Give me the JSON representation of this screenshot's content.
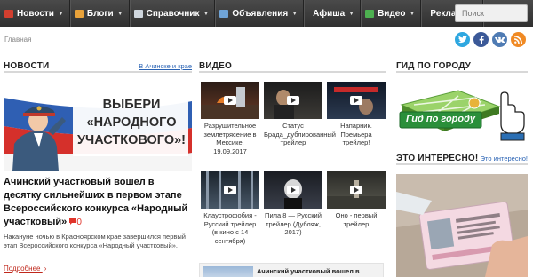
{
  "nav": {
    "items": [
      {
        "label": "Новости",
        "icon": "news-icon",
        "color": "#d33f2f"
      },
      {
        "label": "Блоги",
        "icon": "blog-icon",
        "color": "#e8a23a"
      },
      {
        "label": "Справочник",
        "icon": "directory-icon",
        "color": "#cfd6dd"
      },
      {
        "label": "Объявления",
        "icon": "ads-icon",
        "color": "#6fa3d6"
      },
      {
        "label": "Афиша",
        "icon": "",
        "color": ""
      },
      {
        "label": "Видео",
        "icon": "video-icon",
        "color": "#4db050"
      },
      {
        "label": "Реклама",
        "icon": "",
        "color": ""
      }
    ],
    "search_placeholder": "Поиск"
  },
  "breadcrumb": "Главная",
  "social": [
    {
      "name": "twitter-icon",
      "glyph": "t",
      "color": "#2ea7e0"
    },
    {
      "name": "facebook-icon",
      "glyph": "f",
      "color": "#3b5998"
    },
    {
      "name": "vk-icon",
      "glyph": "vk",
      "color": "#4f7bb3"
    },
    {
      "name": "rss-icon",
      "glyph": "))",
      "color": "#f08a24"
    }
  ],
  "news": {
    "heading": "НОВОСТИ",
    "link": "В Ачинске и крае",
    "banner_text": [
      "ВЫБЕРИ",
      "«НАРОДНОГО",
      "УЧАСТКОВОГО»!"
    ],
    "title": "Ачинский участковый вошел в десятку сильнейших в первом этапе Всероссийского конкурса «Народный участковый»",
    "comments": "0",
    "desc": "Накануне ночью в Красноярском крае завершился первый этап Всероссийского конкурса «Народный участковый».",
    "more": "Подробнее"
  },
  "video": {
    "heading": "ВИДЕО",
    "items": [
      {
        "title": "Разрушительное землетрясение в Мексике, 19.09.2017",
        "tone": "#3a2a22"
      },
      {
        "title": "Статус Брада_дублированный трейлер",
        "tone": "#2b2b2b"
      },
      {
        "title": "Напарник. Премьера трейлер!",
        "tone": "#1e2a3a"
      },
      {
        "title": "Клаустрофобия - Русский трейлер (в кино с 14 сентября)",
        "tone": "#26303a"
      },
      {
        "title": "Пила 8 — Русский трейлер (Дубляж, 2017)",
        "tone": "#22262e"
      },
      {
        "title": "Оно - первый трейлер",
        "tone": "#3a3a34"
      }
    ],
    "card_title": "Ачинский участковый вошел в"
  },
  "guide": {
    "heading": "ГИД ПО ГОРОДУ",
    "banner_text": "Гид по городу"
  },
  "interesting": {
    "heading": "ЭТО ИНТЕРЕСНО!",
    "link": "Это интересно!"
  }
}
